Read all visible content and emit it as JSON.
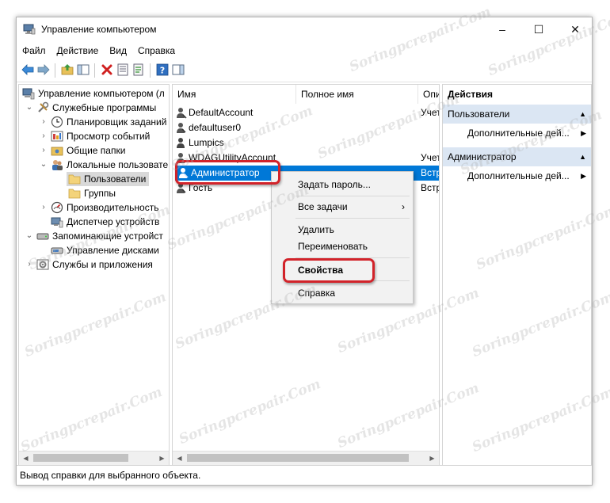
{
  "window": {
    "title": "Управление компьютером",
    "controls": [
      "–",
      "☐",
      "✕"
    ]
  },
  "menu": [
    "Файл",
    "Действие",
    "Вид",
    "Справка"
  ],
  "tree": [
    {
      "label": "Управление компьютером (л",
      "icon": "computer-management-icon"
    },
    {
      "label": "Служебные программы",
      "icon": "tools-icon"
    },
    {
      "label": "Планировщик заданий",
      "icon": "clock-icon"
    },
    {
      "label": "Просмотр событий",
      "icon": "event-viewer-icon"
    },
    {
      "label": "Общие папки",
      "icon": "shared-folder-icon"
    },
    {
      "label": "Локальные пользовате",
      "icon": "local-users-icon"
    },
    {
      "label": "Пользователи",
      "icon": "folder-icon"
    },
    {
      "label": "Группы",
      "icon": "folder-icon"
    },
    {
      "label": "Производительность",
      "icon": "performance-icon"
    },
    {
      "label": "Диспетчер устройств",
      "icon": "device-manager-icon"
    },
    {
      "label": "Запоминающие устройст",
      "icon": "storage-icon"
    },
    {
      "label": "Управление дисками",
      "icon": "disk-icon"
    },
    {
      "label": "Службы и приложения",
      "icon": "services-icon"
    }
  ],
  "columns": [
    "Имя",
    "Полное имя",
    "Опи"
  ],
  "users": [
    {
      "name": "DefaultAccount",
      "desc": "Учет"
    },
    {
      "name": "defaultuser0",
      "desc": ""
    },
    {
      "name": "Lumpics",
      "desc": ""
    },
    {
      "name": "WDAGUtilityAccount",
      "desc": "Учет"
    },
    {
      "name": "Администратор",
      "desc": "Встр"
    },
    {
      "name": "Гость",
      "desc": "Встр"
    }
  ],
  "context_menu": {
    "items": [
      "Задать пароль...",
      "Все задачи",
      "Удалить",
      "Переименовать",
      "Свойства",
      "Справка"
    ],
    "submenu_arrow": "›"
  },
  "actions": {
    "header": "Действия",
    "sections": [
      {
        "title": "Пользователи",
        "item": "Дополнительные дей..."
      },
      {
        "title": "Администратор",
        "item": "Дополнительные дей..."
      }
    ]
  },
  "status": "Вывод справки для выбранного объекта.",
  "watermark": "Soringpcrepair.Com",
  "colors": {
    "selection": "#0078d7",
    "highlight": "#d2232a",
    "section": "#dbe6f3"
  }
}
